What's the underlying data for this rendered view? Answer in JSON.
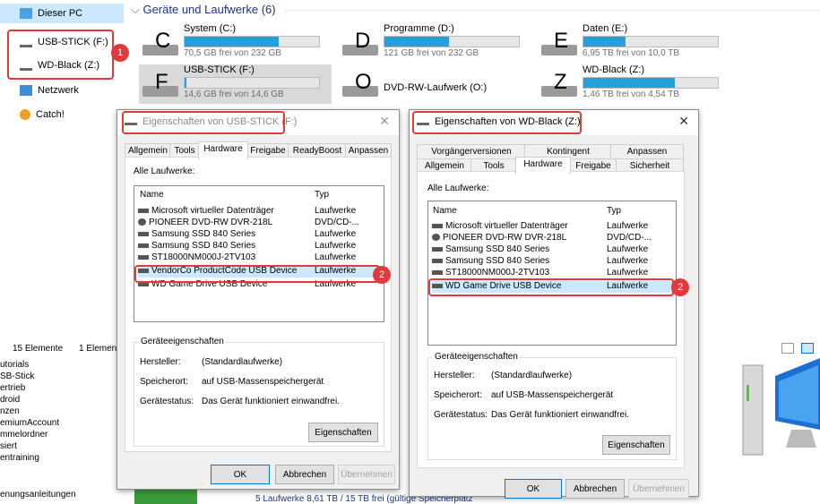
{
  "nav": {
    "items": [
      {
        "label": "Dieser PC"
      },
      {
        "label": "USB-STICK (F:)"
      },
      {
        "label": "WD-Black (Z:)"
      },
      {
        "label": "Netzwerk"
      },
      {
        "label": "Catch!"
      }
    ]
  },
  "drives": {
    "header": "Geräte und Laufwerke (6)",
    "items": [
      {
        "letter": "C",
        "name": "System (C:)",
        "free": "70,5 GB frei von 232 GB",
        "fill_pct": 70
      },
      {
        "letter": "D",
        "name": "Programme (D:)",
        "free": "121 GB frei von 232 GB",
        "fill_pct": 48
      },
      {
        "letter": "E",
        "name": "Daten (E:)",
        "free": "6,95 TB frei von 10,0 TB",
        "fill_pct": 31
      },
      {
        "letter": "F",
        "name": "USB-STICK (F:)",
        "free": "14,6 GB frei von 14,6 GB",
        "fill_pct": 1
      },
      {
        "letter": "O",
        "name": "DVD-RW-Laufwerk (O:)",
        "free": "",
        "fill_pct": 0
      },
      {
        "letter": "Z",
        "name": "WD-Black (Z:)",
        "free": "1,46 TB frei von 4,54 TB",
        "fill_pct": 68
      }
    ]
  },
  "badges": {
    "one": "1",
    "two": "2"
  },
  "status": {
    "count": "15 Elemente",
    "selected": "1 Elemen"
  },
  "lower_list": [
    "utorials",
    "SB-Stick",
    "ertrieb",
    "droid",
    "nzen",
    "emiumAccount",
    "mmelordner",
    "siert",
    "entraining",
    "",
    "enungsanleitungen"
  ],
  "bottom_status": "5 Laufwerke  8,61 TB / 15 TB frei (gültige Speicherplatz",
  "dialog1": {
    "title": "Eigenschaften von USB-STICK (F:)",
    "tabs": [
      "Allgemein",
      "Tools",
      "Hardware",
      "Freigabe",
      "ReadyBoost",
      "Anpassen"
    ],
    "all_drives_label": "Alle Laufwerke:",
    "col_name": "Name",
    "col_type": "Typ",
    "rows": [
      {
        "name": "Microsoft virtueller Datenträger",
        "type": "Laufwerke"
      },
      {
        "name": "PIONEER DVD-RW  DVR-218L",
        "type": "DVD/CD-..."
      },
      {
        "name": "Samsung SSD 840 Series",
        "type": "Laufwerke"
      },
      {
        "name": "Samsung SSD 840 Series",
        "type": "Laufwerke"
      },
      {
        "name": "ST18000NM000J-2TV103",
        "type": "Laufwerke"
      },
      {
        "name": "VendorCo ProductCode USB Device",
        "type": "Laufwerke"
      },
      {
        "name": "WD Game Drive USB Device",
        "type": "Laufwerke"
      }
    ],
    "group_label": "Geräteeigenschaften",
    "manufacturer_label": "Hersteller:",
    "manufacturer": "(Standardlaufwerke)",
    "location_label": "Speicherort:",
    "location": "auf USB-Massenspeichergerät",
    "status_label": "Gerätestatus:",
    "status": "Das Gerät funktioniert einwandfrei.",
    "props_button": "Eigenschaften",
    "ok": "OK",
    "cancel": "Abbrechen",
    "apply": "Übernehmen"
  },
  "dialog2": {
    "title": "Eigenschaften von WD-Black (Z:)",
    "tabs_top": [
      "Vorgängerversionen",
      "Kontingent",
      "Anpassen"
    ],
    "tabs_bottom": [
      "Allgemein",
      "Tools",
      "Hardware",
      "Freigabe",
      "Sicherheit"
    ],
    "all_drives_label": "Alle Laufwerke:",
    "col_name": "Name",
    "col_type": "Typ",
    "rows": [
      {
        "name": "Microsoft virtueller Datenträger",
        "type": "Laufwerke"
      },
      {
        "name": "PIONEER DVD-RW  DVR-218L",
        "type": "DVD/CD-..."
      },
      {
        "name": "Samsung SSD 840 Series",
        "type": "Laufwerke"
      },
      {
        "name": "Samsung SSD 840 Series",
        "type": "Laufwerke"
      },
      {
        "name": "ST18000NM000J-2TV103",
        "type": "Laufwerke"
      },
      {
        "name": "WD Game Drive USB Device",
        "type": "Laufwerke"
      }
    ],
    "group_label": "Geräteeigenschaften",
    "manufacturer_label": "Hersteller:",
    "manufacturer": "(Standardlaufwerke)",
    "location_label": "Speicherort:",
    "location": "auf USB-Massenspeichergerät",
    "status_label": "Gerätestatus:",
    "status": "Das Gerät funktioniert einwandfrei.",
    "props_button": "Eigenschaften",
    "ok": "OK",
    "cancel": "Abbrechen",
    "apply": "Übernehmen"
  },
  "colors": {
    "accent": "#26a0da",
    "callout": "#e03a3a",
    "selection": "#cce8ff"
  }
}
